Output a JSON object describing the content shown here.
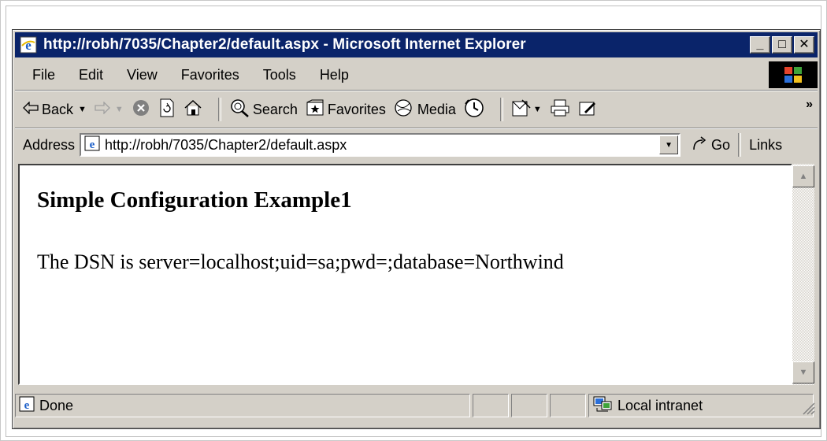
{
  "window": {
    "title": "http://robh/7035/Chapter2/default.aspx - Microsoft Internet Explorer",
    "controls": {
      "minimize": "_",
      "maximize": "□",
      "close": "✕"
    }
  },
  "menu": {
    "items": [
      "File",
      "Edit",
      "View",
      "Favorites",
      "Tools",
      "Help"
    ]
  },
  "toolbar": {
    "back_label": "Back",
    "search_label": "Search",
    "favorites_label": "Favorites",
    "media_label": "Media"
  },
  "address": {
    "label": "Address",
    "value": "http://robh/7035/Chapter2/default.aspx",
    "go_label": "Go",
    "links_label": "Links"
  },
  "page": {
    "heading": "Simple Configuration Example1",
    "text": "The DSN is server=localhost;uid=sa;pwd=;database=Northwind"
  },
  "status": {
    "text": "Done",
    "zone": "Local intranet"
  },
  "colors": {
    "titlebar": "#0a246a",
    "chrome": "#d4d0c8"
  }
}
